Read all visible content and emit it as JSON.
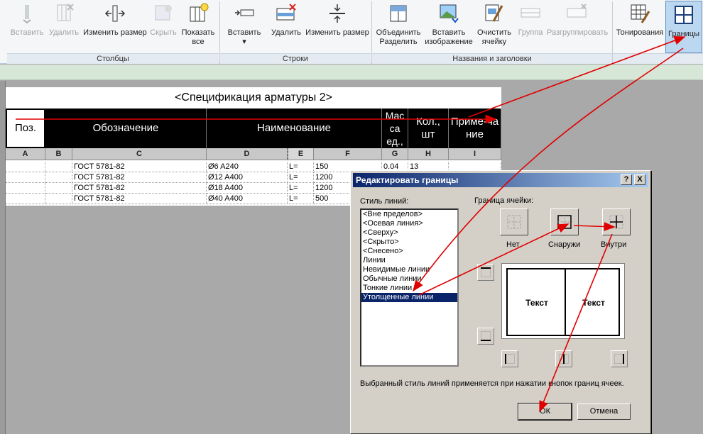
{
  "ribbon": {
    "buttons": [
      {
        "label": "Вставить",
        "icon": "insert-column-icon",
        "disabled": true
      },
      {
        "label": "Удалить",
        "icon": "delete-column-icon",
        "disabled": true
      },
      {
        "label": "Изменить размер",
        "icon": "resize-column-icon",
        "disabled": false
      },
      {
        "label": "Скрыть",
        "icon": "hide-column-icon",
        "disabled": true
      },
      {
        "label": "Показать все",
        "icon": "show-all-icon",
        "disabled": false
      },
      {
        "label": "Вставить",
        "icon": "insert-row-icon",
        "disabled": false
      },
      {
        "label": "Удалить",
        "icon": "delete-row-icon",
        "disabled": false
      },
      {
        "label": "Изменить размер",
        "icon": "resize-row-icon",
        "disabled": false
      },
      {
        "label": "Объединить Разделить",
        "icon": "merge-unmerge-icon",
        "disabled": false
      },
      {
        "label": "Вставить изображение",
        "icon": "insert-image-icon",
        "disabled": false
      },
      {
        "label": "Очистить ячейку",
        "icon": "clear-cell-icon",
        "disabled": false
      },
      {
        "label": "Группа",
        "icon": "group-icon",
        "disabled": true
      },
      {
        "label": "Разгруппировать",
        "icon": "ungroup-icon",
        "disabled": true
      },
      {
        "label": "Тонирования",
        "icon": "shading-icon",
        "disabled": false
      },
      {
        "label": "Границы",
        "icon": "borders-icon",
        "disabled": false
      }
    ],
    "panels": {
      "columns": "Столбцы",
      "rows": "Строки",
      "titles": "Названия и заголовки"
    }
  },
  "schedule": {
    "title": "<Спецификация арматуры 2>",
    "headers": [
      "Поз.",
      "Обозначение",
      "Наименование",
      "Мас са ед.,",
      "Кол., шт",
      "Приме-ча ние"
    ],
    "letters": [
      "A",
      "B",
      "C",
      "D",
      "E",
      "F",
      "G",
      "H",
      "I"
    ],
    "rows": [
      [
        "",
        "",
        "ГОСТ 5781-82",
        "Ø6 A240",
        "L=",
        "150",
        "0.04",
        "13",
        ""
      ],
      [
        "",
        "",
        "ГОСТ 5781-82",
        "Ø12 A400",
        "L=",
        "1200",
        "",
        "",
        ""
      ],
      [
        "",
        "",
        "ГОСТ 5781-82",
        "Ø18 A400",
        "L=",
        "1200",
        "",
        "",
        ""
      ],
      [
        "",
        "",
        "ГОСТ 5781-82",
        "Ø40 A400",
        "L=",
        "500",
        "",
        "",
        ""
      ]
    ]
  },
  "dialog": {
    "title": "Редактировать границы",
    "help": "?",
    "close": "X",
    "line_style_label": "Стиль линий:",
    "cell_border_label": "Граница ячейки:",
    "line_styles": [
      "<Вне пределов>",
      "<Осевая линия>",
      "<Сверху>",
      "<Скрыто>",
      "<Снесено>",
      "Линии",
      "Невидимые линии",
      "Обычные линии",
      "Тонкие линии",
      "Утолщенные линии"
    ],
    "selected_style": "Утолщенные линии",
    "presets": {
      "none": "Нет",
      "outside": "Снаружи",
      "inside": "Внутри"
    },
    "preview_text": [
      "Текст",
      "Текст"
    ],
    "hint": "Выбранный стиль линий применяется при нажатии кнопок границ ячеек.",
    "ok": "ОК",
    "cancel": "Отмена"
  },
  "colors": {
    "annotation": "#e00000",
    "selection": "#0a246a",
    "title_bar": "#0a246a"
  }
}
